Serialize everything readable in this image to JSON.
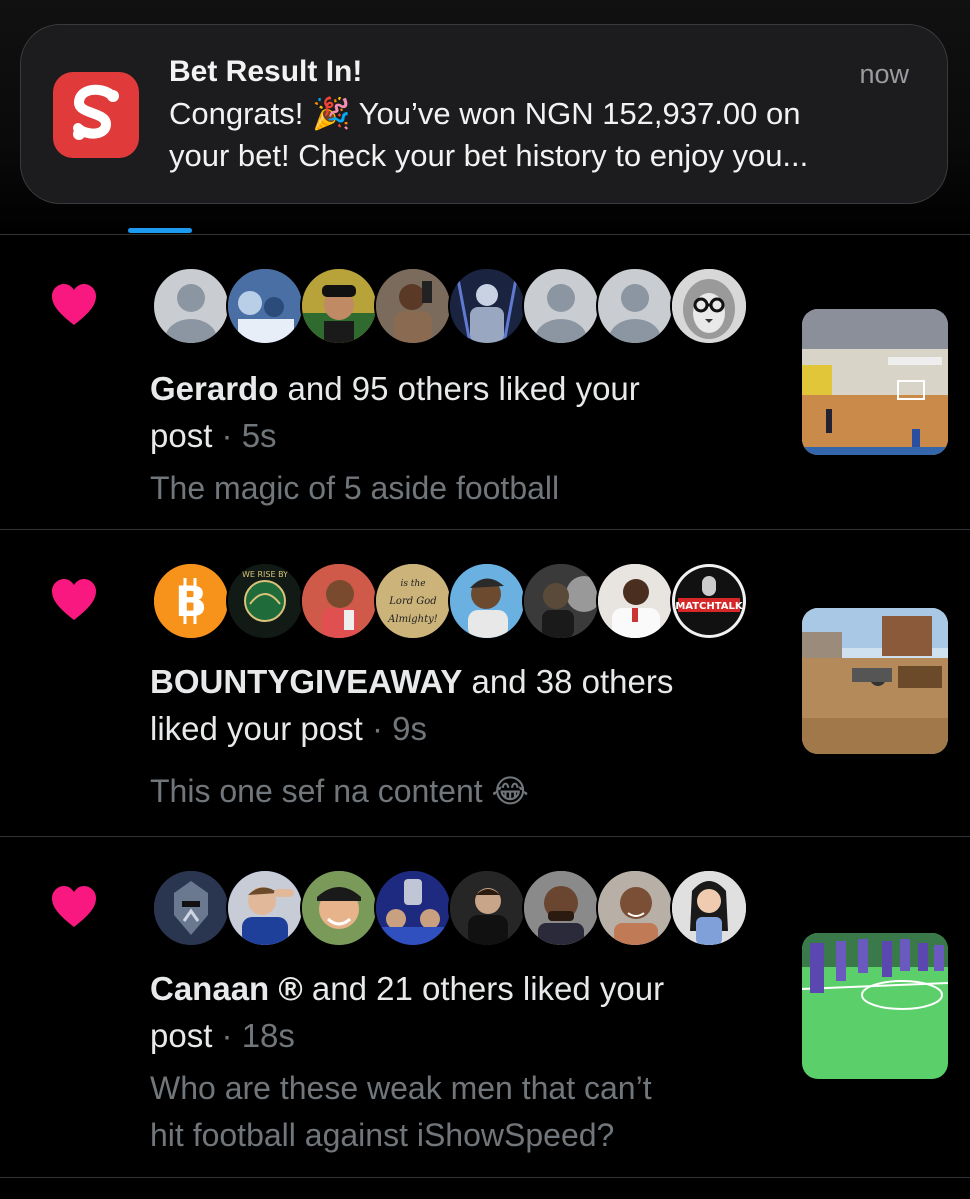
{
  "notification": {
    "app_icon": "stake-s-icon",
    "title": "Bet Result In!",
    "time": "now",
    "body_line1": "Congrats! 🎉 You’ve won NGN 152,937.00 on",
    "body_line2": "your bet! Check your bet history to enjoy you..."
  },
  "colors": {
    "accent": "#1d9bf0",
    "heart": "#f91880",
    "muted": "#71767b",
    "app_icon_bg": "#e03a3a"
  },
  "notifications": [
    {
      "icon": "heart-icon",
      "name": "Gerardo",
      "action_line1": " and 95 others liked your",
      "action_line2": "post",
      "time": "5s",
      "excerpt_line1": "The magic of 5 aside football",
      "excerpt_line2": ""
    },
    {
      "icon": "heart-icon",
      "name": "BOUNTYGIVEAWAY",
      "action_line1": " and 38 others",
      "action_line2": "liked your post",
      "time": "9s",
      "excerpt_line1": "This one sef na content 😂",
      "excerpt_line2": ""
    },
    {
      "icon": "heart-icon",
      "name": "Canaan ®",
      "action_line1": " and 21 others liked your",
      "action_line2": "post",
      "time": "18s",
      "excerpt_line1": "Who are these weak men that can’t",
      "excerpt_line2": "hit football against iShowSpeed?"
    }
  ],
  "avatar_labels": {
    "rise": "WE RISE BY",
    "lord": "is the Lord God Almighty!",
    "matchtalk": "MATCHTALK"
  },
  "separator": " · "
}
